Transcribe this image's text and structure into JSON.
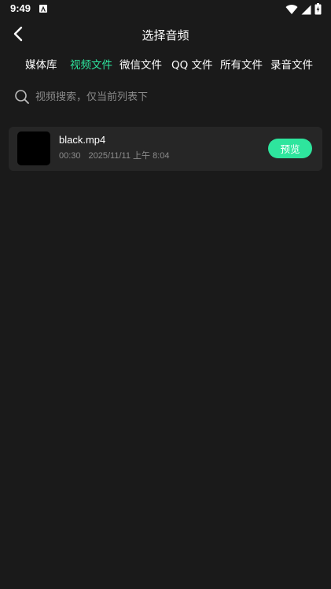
{
  "status": {
    "time": "9:49"
  },
  "header": {
    "title": "选择音频",
    "back_icon": "chevron-left-icon"
  },
  "tabs": [
    {
      "label": "媒体库",
      "active": false
    },
    {
      "label": "视频文件",
      "active": true
    },
    {
      "label": "微信文件",
      "active": false
    },
    {
      "label": "QQ 文件",
      "active": false
    },
    {
      "label": "所有文件",
      "active": false
    },
    {
      "label": "录音文件",
      "active": false
    }
  ],
  "search": {
    "value": "",
    "placeholder": "视频搜索，仅当前列表下"
  },
  "files": [
    {
      "name": "black.mp4",
      "duration": "00:30",
      "date": "2025/11/11 上午 8:04",
      "preview_label": "预览"
    }
  ],
  "colors": {
    "background": "#1a1a1a",
    "accent": "#2ee59d",
    "card": "#262626",
    "muted_text": "#8c8c8c"
  }
}
